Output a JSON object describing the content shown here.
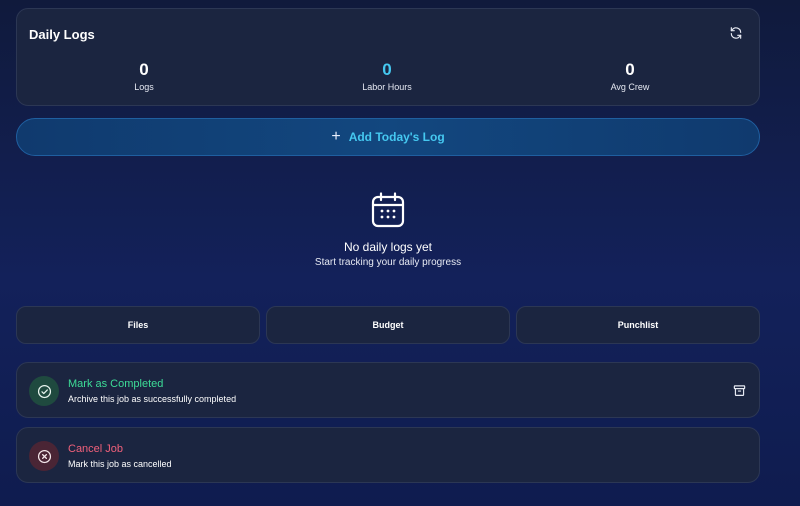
{
  "daily_logs": {
    "title": "Daily Logs",
    "refresh_icon": "refresh-icon",
    "stats": [
      {
        "value": "0",
        "label": "Logs",
        "color": "#ffffff"
      },
      {
        "value": "0",
        "label": "Labor Hours",
        "color": "#45c8f0"
      },
      {
        "value": "0",
        "label": "Avg Crew",
        "color": "#ffffff"
      }
    ]
  },
  "add_log": {
    "icon": "plus-icon",
    "plus": "+",
    "label": "Add Today's Log"
  },
  "empty_state": {
    "icon": "calendar-icon",
    "title": "No daily logs yet",
    "subtitle": "Start tracking your daily progress"
  },
  "tabs": [
    {
      "label": "Files"
    },
    {
      "label": "Budget"
    },
    {
      "label": "Punchlist"
    }
  ],
  "actions": {
    "complete": {
      "icon": "check-circle-icon",
      "title": "Mark as Completed",
      "description": "Archive this job as successfully completed",
      "color": "#3ddc97",
      "secondary_icon": "archive-icon"
    },
    "cancel": {
      "icon": "x-circle-icon",
      "title": "Cancel Job",
      "description": "Mark this job as cancelled",
      "color": "#f0607a"
    }
  }
}
